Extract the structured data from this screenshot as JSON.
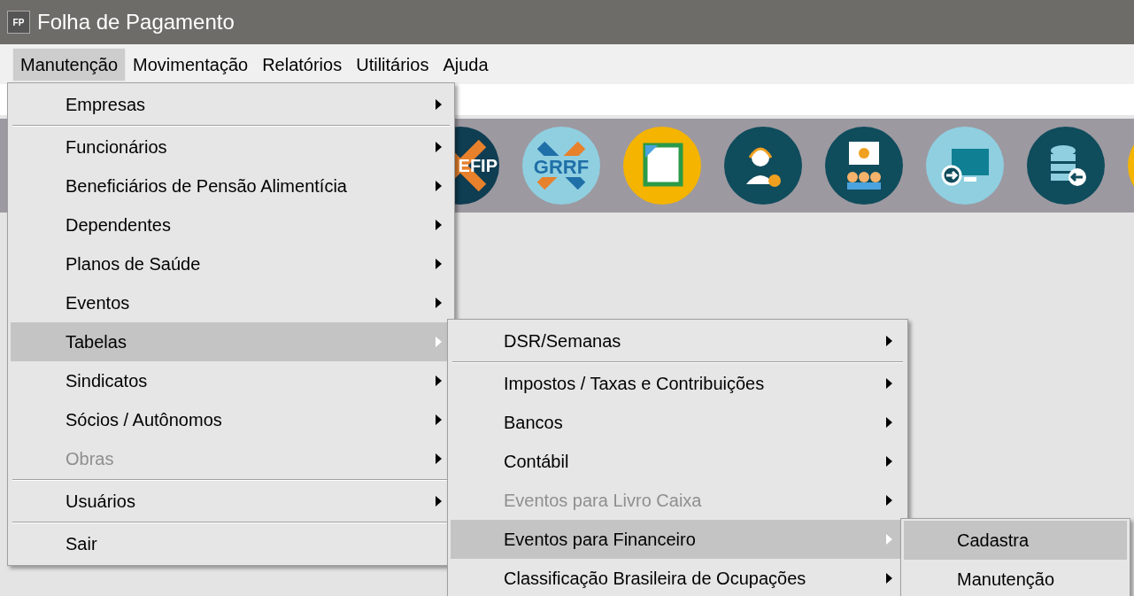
{
  "window": {
    "icon_text": "FP",
    "title": "Folha de Pagamento"
  },
  "menubar": [
    {
      "label": "Manutenção",
      "selected": true
    },
    {
      "label": "Movimentação",
      "selected": false
    },
    {
      "label": "Relatórios",
      "selected": false
    },
    {
      "label": "Utilitários",
      "selected": false
    },
    {
      "label": "Ajuda",
      "selected": false
    }
  ],
  "toolbar": [
    {
      "kind": "efip",
      "label": "EFIP"
    },
    {
      "kind": "grrf",
      "label": "GRRF"
    },
    {
      "kind": "document"
    },
    {
      "kind": "support"
    },
    {
      "kind": "meeting"
    },
    {
      "kind": "monitor"
    },
    {
      "kind": "database"
    },
    {
      "kind": "partial"
    }
  ],
  "menus": [
    {
      "items": [
        {
          "label": "Empresas",
          "selected": false,
          "disabled": false,
          "separator_after": true
        },
        {
          "label": "Funcionários",
          "selected": false,
          "disabled": false,
          "separator_after": false
        },
        {
          "label": "Beneficiários de Pensão Alimentícia",
          "selected": false,
          "disabled": false,
          "separator_after": false
        },
        {
          "label": "Dependentes",
          "selected": false,
          "disabled": false,
          "separator_after": false
        },
        {
          "label": "Planos de Saúde",
          "selected": false,
          "disabled": false,
          "separator_after": false
        },
        {
          "label": "Eventos",
          "selected": false,
          "disabled": false,
          "separator_after": false
        },
        {
          "label": "Tabelas",
          "selected": true,
          "disabled": false,
          "separator_after": false
        },
        {
          "label": "Sindicatos",
          "selected": false,
          "disabled": false,
          "separator_after": false
        },
        {
          "label": "Sócios / Autônomos",
          "selected": false,
          "disabled": false,
          "separator_after": false
        },
        {
          "label": "Obras",
          "selected": false,
          "disabled": true,
          "separator_after": true
        },
        {
          "label": "Usuários",
          "selected": false,
          "disabled": false,
          "separator_after": true
        },
        {
          "label": "Sair",
          "selected": false,
          "disabled": false,
          "separator_after": false,
          "has_submenu": false
        }
      ]
    },
    {
      "items": [
        {
          "label": "DSR/Semanas",
          "selected": false,
          "disabled": false,
          "separator_after": true
        },
        {
          "label": "Impostos / Taxas e Contribuições",
          "selected": false,
          "disabled": false,
          "separator_after": false
        },
        {
          "label": "Bancos",
          "selected": false,
          "disabled": false,
          "separator_after": false
        },
        {
          "label": "Contábil",
          "selected": false,
          "disabled": false,
          "separator_after": false
        },
        {
          "label": "Eventos para Livro Caixa",
          "selected": false,
          "disabled": true,
          "separator_after": false
        },
        {
          "label": "Eventos para Financeiro",
          "selected": true,
          "disabled": false,
          "separator_after": false
        },
        {
          "label": "Classificação Brasileira de Ocupações",
          "selected": false,
          "disabled": false,
          "separator_after": false
        }
      ]
    },
    {
      "items": [
        {
          "label": "Cadastra",
          "selected": true,
          "disabled": false,
          "has_submenu": false
        },
        {
          "label": "Manutenção",
          "selected": false,
          "disabled": false,
          "has_submenu": false
        }
      ]
    }
  ]
}
